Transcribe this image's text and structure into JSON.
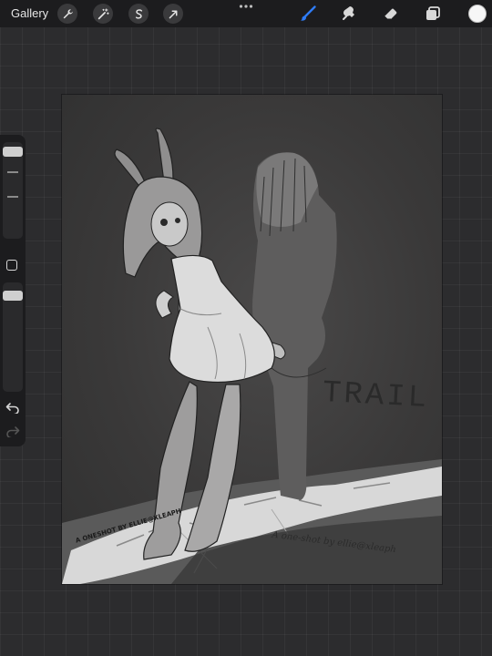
{
  "topbar": {
    "gallery_label": "Gallery",
    "actions_icon": "wrench-icon",
    "adjustments_icon": "magic-wand-icon",
    "selection_icon": "selection-s-icon",
    "transform_icon": "arrow-cursor-icon",
    "more_icon": "ellipsis-icon",
    "brush_icon": "brush-icon",
    "smudge_icon": "smudge-icon",
    "eraser_icon": "eraser-icon",
    "layers_icon": "layers-icon",
    "color": "#f7f7f7",
    "accent": "#2f7cf6"
  },
  "sidebar": {
    "brush_size_level": 0.05,
    "opacity_level": 0.08,
    "undo_icon": "undo-icon",
    "redo_icon": "redo-icon"
  },
  "canvas": {
    "title_text": "TRAIL",
    "signature_left": "A ONESHOT BY ELLIE@XLEAPH",
    "signature_right": "A one-shot by ellie@xleaph"
  }
}
